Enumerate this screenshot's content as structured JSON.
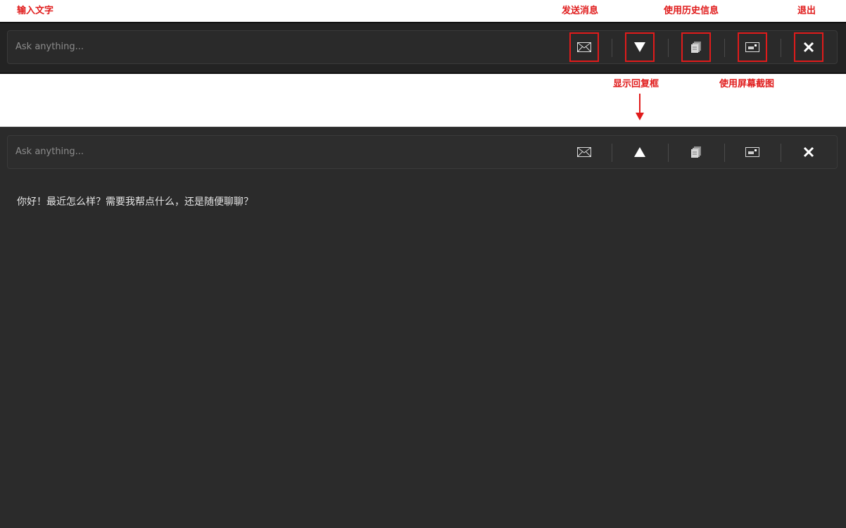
{
  "annotations": {
    "input_text": "输入文字",
    "send_message": "发送消息",
    "use_history": "使用历史信息",
    "exit": "退出",
    "show_reply": "显示回复框",
    "use_screenshot": "使用屏幕截图"
  },
  "toolbar": {
    "placeholder": "Ask anything...",
    "icons": [
      "envelope-icon",
      "triangle-down-icon",
      "stack-icon",
      "screenshot-icon",
      "close-icon"
    ],
    "expanded_toggle_icon": "triangle-up-icon"
  },
  "reply": {
    "text": "你好！最近怎么样？需要我帮点什么，还是随便聊聊？"
  },
  "colors": {
    "annotation": "#e01b1b",
    "panel_bg": "#2b2b2b",
    "bar_bg": "#2a2a2a",
    "icon": "#e0e0e0"
  }
}
